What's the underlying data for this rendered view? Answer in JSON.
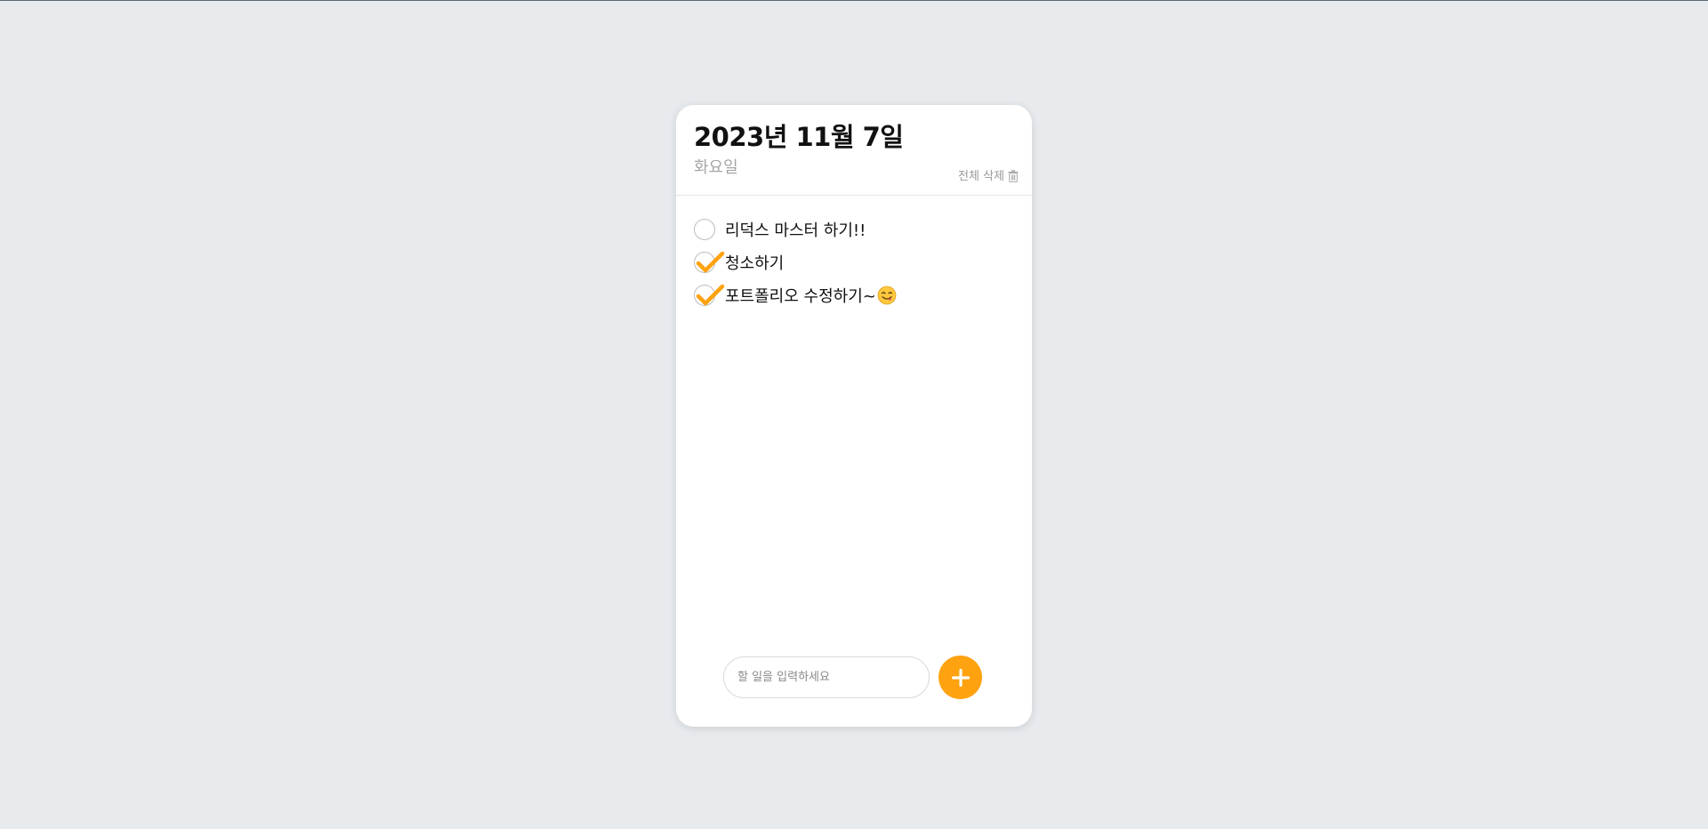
{
  "header": {
    "date": "2023년 11월 7일",
    "weekday": "화요일",
    "clear_all_label": "전체 삭제",
    "clear_all_icon": "trash-icon"
  },
  "todos": [
    {
      "text": "리덕스 마스터 하기!!",
      "done": false
    },
    {
      "text": "청소하기",
      "done": true
    },
    {
      "text": "포트폴리오 수정하기~",
      "done": true,
      "emoji": "yum-face-emoji"
    }
  ],
  "input": {
    "placeholder": "할 일을 입력하세요",
    "value": ""
  },
  "add_button": {
    "icon": "plus-icon"
  },
  "colors": {
    "accent": "#ffa20f",
    "background": "#e7ebee",
    "card": "#ffffff",
    "muted_text": "#a6a6a6"
  }
}
